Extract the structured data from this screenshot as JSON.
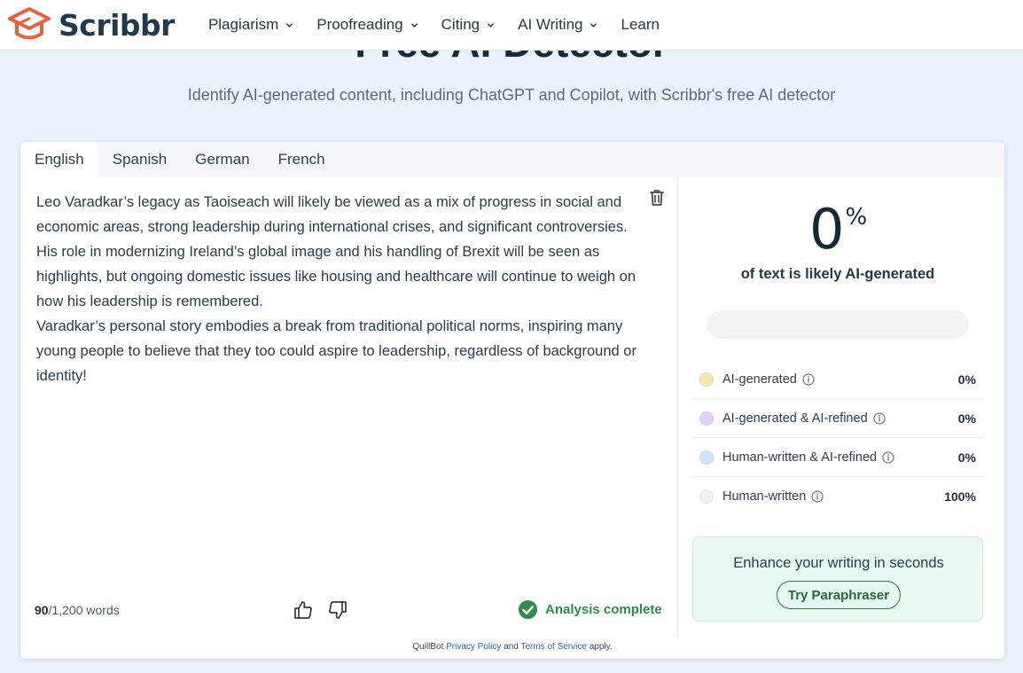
{
  "nav": {
    "brand": "Scribbr",
    "items": [
      {
        "label": "Plagiarism",
        "has_dropdown": true
      },
      {
        "label": "Proofreading",
        "has_dropdown": true
      },
      {
        "label": "Citing",
        "has_dropdown": true
      },
      {
        "label": "AI Writing",
        "has_dropdown": true
      },
      {
        "label": "Learn",
        "has_dropdown": false
      }
    ]
  },
  "hero": {
    "title": "Free AI Detector",
    "subtitle": "Identify AI-generated content, including ChatGPT and Copilot, with Scribbr's free AI detector"
  },
  "tabs": [
    {
      "label": "English",
      "active": true
    },
    {
      "label": "Spanish",
      "active": false
    },
    {
      "label": "German",
      "active": false
    },
    {
      "label": "French",
      "active": false
    }
  ],
  "editor": {
    "paragraphs": [
      "Leo Varadkar’s legacy as Taoiseach will likely be viewed as a mix of progress in social and economic areas, strong leadership during international crises, and significant controversies. His role in modernizing Ireland’s global image and his handling of Brexit will be seen as highlights, but ongoing domestic issues like housing and healthcare will continue to weigh on how his leadership is remembered.",
      "Varadkar’s personal story embodies a break from traditional political norms, inspiring many young people to believe that they too could aspire to leadership, regardless of background or identity!"
    ],
    "word_count": "90",
    "word_limit": "/1,200 words",
    "status": "Analysis complete"
  },
  "results": {
    "score": "0",
    "score_unit": "%",
    "caption": "of text is likely AI-generated",
    "ai_fraction": 0,
    "legend": [
      {
        "label": "AI-generated",
        "value": "0%",
        "color": "#f6e3b4"
      },
      {
        "label": "AI-generated & AI-refined",
        "value": "0%",
        "color": "#e2d1f7"
      },
      {
        "label": "Human-written & AI-refined",
        "value": "0%",
        "color": "#cfe2fa"
      },
      {
        "label": "Human-written",
        "value": "100%",
        "color": "#f0f1f2"
      }
    ],
    "promo": {
      "text": "Enhance your writing in seconds",
      "button": "Try Paraphraser"
    }
  },
  "footer": {
    "prefix": "QuillBot",
    "privacy": "Privacy Policy",
    "and": "and",
    "terms": "Terms of Service",
    "suffix": "apply."
  },
  "colors": {
    "brand_orange": "#e8613a",
    "brand_dark": "#1f3a4e",
    "success_green": "#2e8b4a"
  }
}
